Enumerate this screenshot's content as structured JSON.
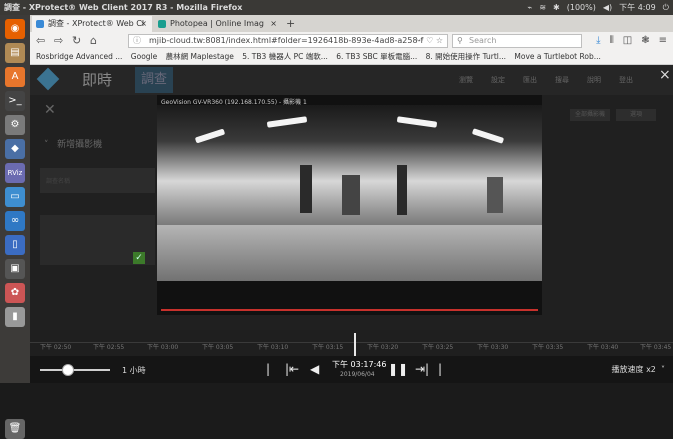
{
  "os": {
    "window_title": "調查 - XProtect® Web Client 2017 R3 - Mozilla Firefox",
    "tray": [
      "(100%)",
      "下午 4:09"
    ]
  },
  "launcher": {
    "icons": [
      {
        "name": "firefox",
        "color": "#e66000"
      },
      {
        "name": "files",
        "color": "#b08a55"
      },
      {
        "name": "software",
        "color": "#e8762c"
      },
      {
        "name": "terminal",
        "color": "#444"
      },
      {
        "name": "settings",
        "color": "#7a7a7a"
      },
      {
        "name": "app1",
        "color": "#4a6fa5"
      },
      {
        "name": "rviz",
        "color": "#6b6bb0"
      },
      {
        "name": "app2",
        "color": "#3e8ed0"
      },
      {
        "name": "app3",
        "color": "#2f78c4"
      },
      {
        "name": "app4",
        "color": "#555"
      },
      {
        "name": "app5",
        "color": "#777"
      },
      {
        "name": "app6",
        "color": "#c55"
      },
      {
        "name": "app7",
        "color": "#999"
      },
      {
        "name": "trash",
        "color": "#666"
      }
    ],
    "rviz_label": "RViz"
  },
  "browser": {
    "tabs": [
      {
        "label": "調查 - XProtect® Web Cl",
        "close": "×",
        "color": "#3a8ad6"
      },
      {
        "label": "Photopea | Online Imag",
        "close": "×",
        "color": "#1a9e8f"
      }
    ],
    "new_tab": "+",
    "url": "mjib-cloud.tw:8081/index.html#folder=1926418b-893e-4ad8-a258-f",
    "url_icons": "··· ♡ ☆",
    "search_placeholder": "Search",
    "bookmarks": [
      "Rosbridge Advanced ...",
      "Google",
      "農林網 Maplestage",
      "5. TB3 機器人 PC 端軟...",
      "6. TB3 SBC 單板電腦...",
      "8. 開始使用操作 Turtl...",
      "Move a Turtlebot Rob..."
    ]
  },
  "app": {
    "title": "即時",
    "tab2": "調查",
    "header_items": [
      "瀏覽",
      "設定",
      "匯出",
      "搜尋",
      "說明",
      "登出"
    ],
    "panel_label": "新增攝影機",
    "panel_box_text": "調查名稱",
    "dropdowns": [
      "全部攝影機",
      "選項"
    ],
    "overlay_close": "×"
  },
  "video": {
    "title": "GeoVision GV-VR360 (192.168.170.55) - 攝影機 1"
  },
  "timeline": {
    "ticks": [
      "下午 02:50",
      "下午 02:55",
      "下午 03:00",
      "下午 03:05",
      "下午 03:10",
      "下午 03:15",
      "下午 03:20",
      "下午 03:25",
      "下午 03:30",
      "下午 03:35",
      "下午 03:40",
      "下午 03:45"
    ]
  },
  "controls": {
    "zoom_label": "1 小時",
    "current_time": "下午 03:17:46",
    "current_date": "2019/06/04",
    "speed_label": "播放速度 x2",
    "speed_caret": "˅"
  },
  "colors": {
    "accent": "#2d5f7e",
    "timeline_cursor": "#e8e8e8",
    "video_bar": "#c7312c"
  }
}
